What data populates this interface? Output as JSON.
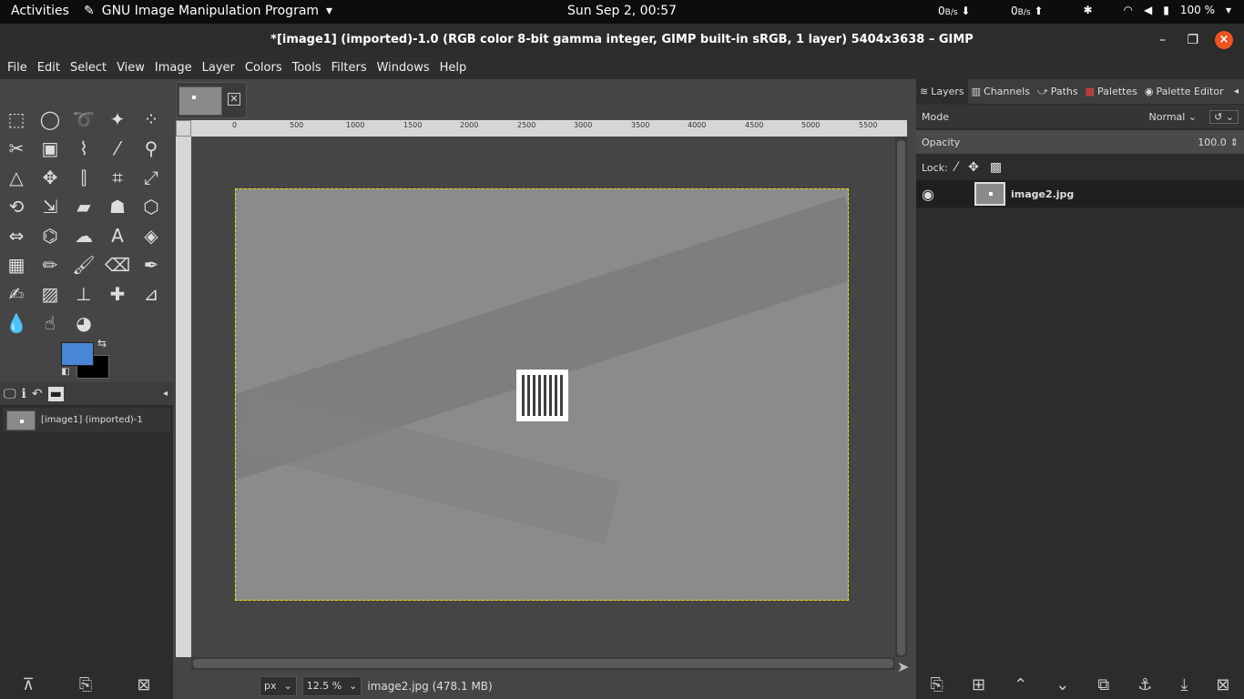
{
  "topbar": {
    "activities": "Activities",
    "app_name": "GNU Image Manipulation Program",
    "clock": "Sun Sep  2, 00:57",
    "net_down_value": "0",
    "net_down_unit": "B/s",
    "net_up_value": "0",
    "net_up_unit": "B/s",
    "battery": "100 %"
  },
  "window": {
    "title": "*[image1] (imported)-1.0 (RGB color 8-bit gamma integer, GIMP built-in sRGB, 1 layer) 5404x3638 – GIMP",
    "close_glyph": "×"
  },
  "menu": [
    "File",
    "Edit",
    "Select",
    "View",
    "Image",
    "Layer",
    "Colors",
    "Tools",
    "Filters",
    "Windows",
    "Help"
  ],
  "colors": {
    "foreground": "#4a86d7",
    "background": "#000000",
    "accent": "#e95420",
    "selection": "#f0e000"
  },
  "images_panel": {
    "entry": "[image1] (imported)-1"
  },
  "ruler": {
    "h_labels": [
      "0",
      "500",
      "1000",
      "1500",
      "2000",
      "2500",
      "3000",
      "3500",
      "4000",
      "4500",
      "5000",
      "5500"
    ]
  },
  "status": {
    "unit": "px",
    "zoom": "12.5 %",
    "file_info": "image2.jpg (478.1 MB)"
  },
  "layers": {
    "tabs": [
      "Layers",
      "Channels",
      "Paths",
      "Palettes",
      "Palette Editor"
    ],
    "mode_label": "Mode",
    "mode_value": "Normal",
    "opacity_label": "Opacity",
    "opacity_value": "100.0",
    "lock_label": "Lock:",
    "items": [
      {
        "name": "image2.jpg",
        "visible": true
      }
    ]
  }
}
